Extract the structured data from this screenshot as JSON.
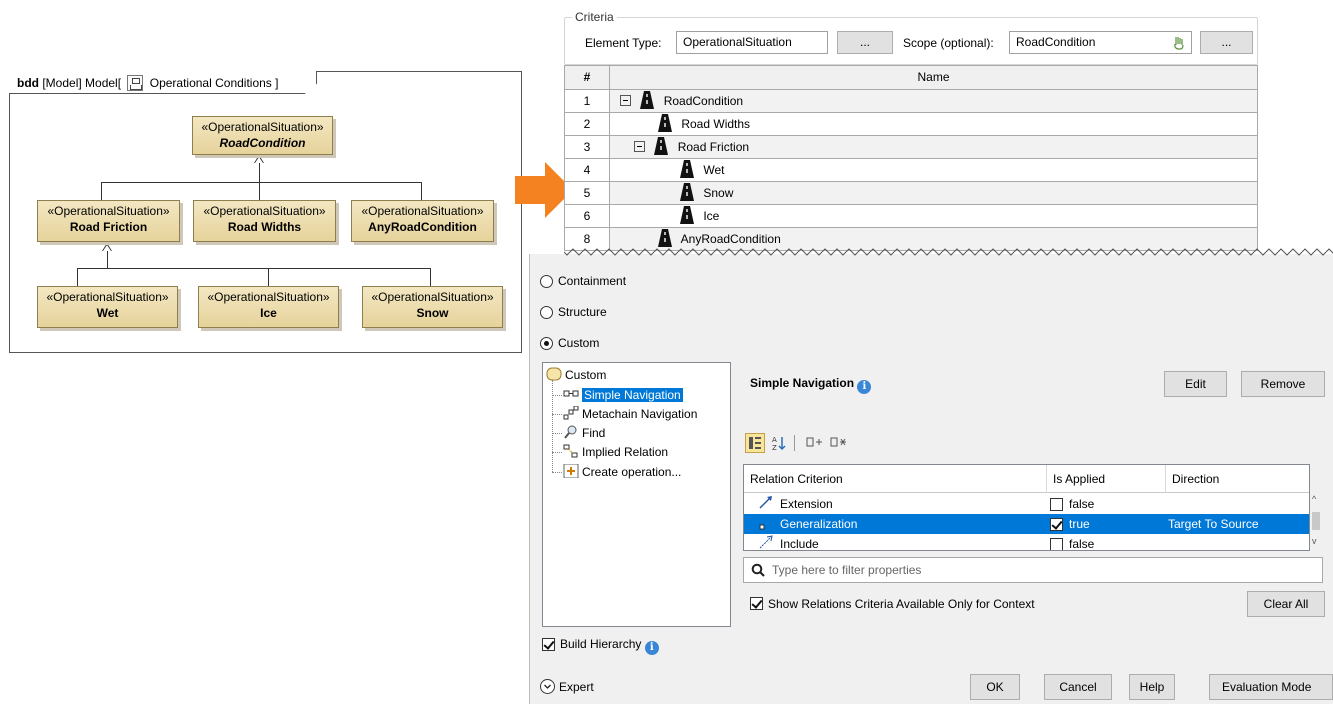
{
  "bdd": {
    "tab": {
      "keyword": "bdd",
      "prefix": "[Model] Model[",
      "name": "Operational Conditions ]"
    },
    "stereotype": "«OperationalSituation»",
    "blocks": {
      "road_condition": "RoadCondition",
      "road_friction": "Road Friction",
      "road_widths": "Road Widths",
      "any_road_condition": "AnyRoadCondition",
      "wet": "Wet",
      "ice": "Ice",
      "snow": "Snow"
    }
  },
  "colors": {
    "arrow": "#f58220",
    "selection": "#0078d7",
    "block_fill": "#ecdcae"
  },
  "criteria": {
    "legend": "Criteria",
    "element_type_label": "Element Type:",
    "element_type_value": "OperationalSituation",
    "browse_label": "...",
    "scope_label": "Scope (optional):",
    "scope_value": "RoadCondition"
  },
  "table": {
    "col_num": "#",
    "col_name": "Name",
    "rows": [
      {
        "num": "1",
        "name": "RoadCondition"
      },
      {
        "num": "2",
        "name": "Road Widths"
      },
      {
        "num": "3",
        "name": "Road Friction"
      },
      {
        "num": "4",
        "name": "Wet"
      },
      {
        "num": "5",
        "name": "Snow"
      },
      {
        "num": "6",
        "name": "Ice"
      },
      {
        "num": "8",
        "name": "AnyRoadCondition"
      }
    ]
  },
  "dialog": {
    "options": {
      "containment": "Containment",
      "structure": "Structure",
      "custom": "Custom"
    },
    "tree": {
      "root": "Custom",
      "items": [
        "Simple Navigation",
        "Metachain Navigation",
        "Find",
        "Implied Relation",
        "Create operation..."
      ]
    },
    "panel_title": "Simple Navigation",
    "edit_label": "Edit",
    "remove_label": "Remove",
    "props": {
      "headers": [
        "Relation Criterion",
        "Is Applied",
        "Direction"
      ],
      "rows": [
        {
          "criterion": "Extension",
          "applied": "false",
          "direction": ""
        },
        {
          "criterion": "Generalization",
          "applied": "true",
          "direction": "Target To Source"
        },
        {
          "criterion": "Include",
          "applied": "false",
          "direction": ""
        }
      ]
    },
    "filter_placeholder": "Type here to filter properties",
    "context_only_label": "Show Relations Criteria Available Only for Context",
    "clear_all_label": "Clear All",
    "build_hierarchy_label": "Build Hierarchy",
    "expert_label": "Expert",
    "ok_label": "OK",
    "cancel_label": "Cancel",
    "help_label": "Help",
    "eval_mode_label": "Evaluation Mode"
  }
}
